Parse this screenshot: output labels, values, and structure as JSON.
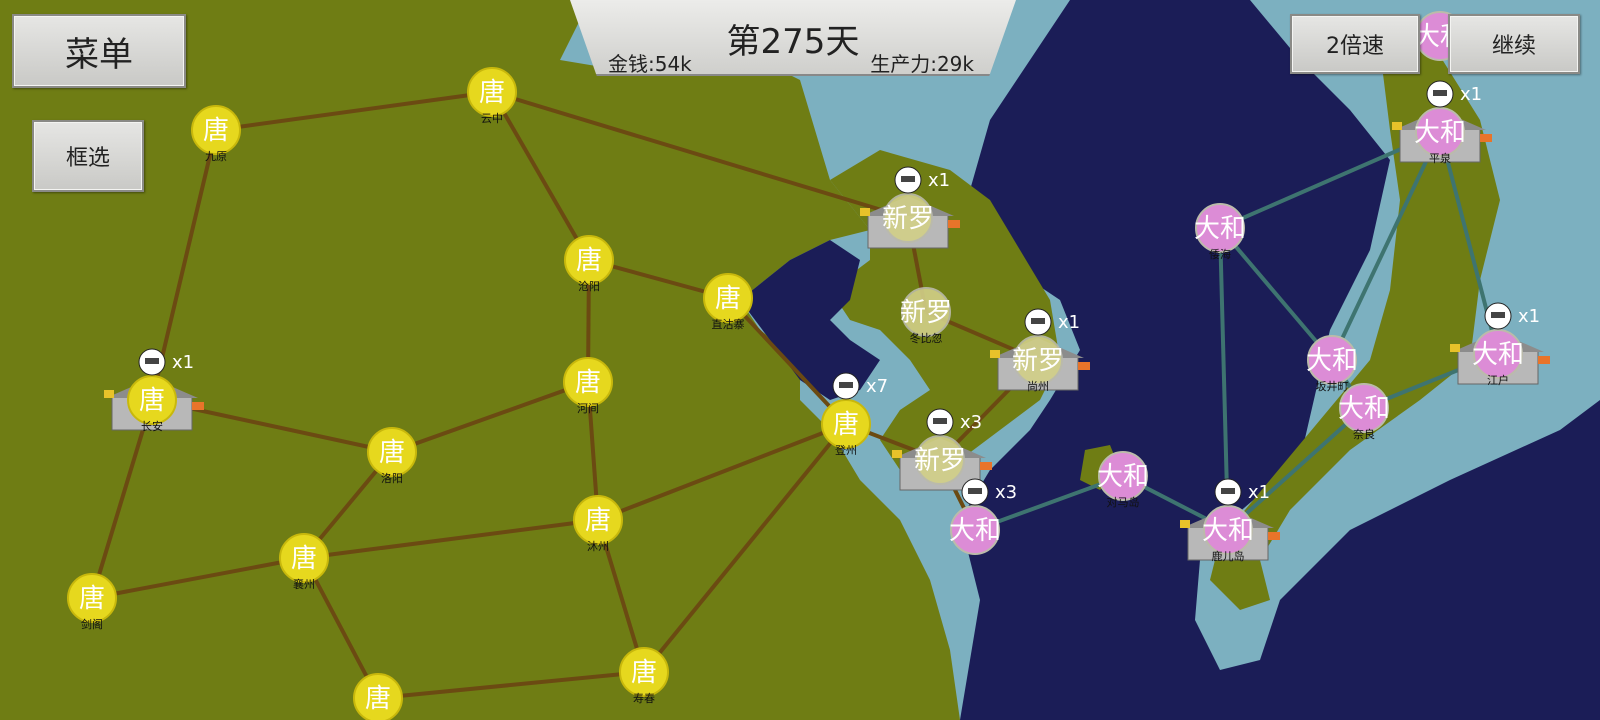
{
  "hud": {
    "day": "第275天",
    "money": "金钱:54k",
    "production": "生产力:29k"
  },
  "buttons": {
    "menu": "菜单",
    "select": "框选",
    "speed": "2倍速",
    "continue": "继续"
  },
  "colors": {
    "tang": "#e6d81e",
    "silla": "#d2d088",
    "yamato": "#dc8cd6",
    "land": "#6f7d14",
    "shallow_sea": "#7cb0c0",
    "deep_sea": "#1b1d57",
    "road": "#6b4a12",
    "sea_route": "#3e7470"
  },
  "map": {
    "cities": [
      {
        "id": "c1",
        "faction": "唐",
        "kind": "tang",
        "name": "九原"
      },
      {
        "id": "c2",
        "faction": "唐",
        "kind": "tang",
        "name": "云中"
      },
      {
        "id": "c3",
        "faction": "唐",
        "kind": "tang",
        "name": "沧阳"
      },
      {
        "id": "c4",
        "faction": "唐",
        "kind": "tang",
        "name": "直沽寨"
      },
      {
        "id": "c5",
        "faction": "唐",
        "kind": "tang",
        "name": "河间"
      },
      {
        "id": "c6",
        "faction": "唐",
        "kind": "tang",
        "name": "长安",
        "army": "x1",
        "castle": true
      },
      {
        "id": "c7",
        "faction": "唐",
        "kind": "tang",
        "name": "洛阳"
      },
      {
        "id": "c8",
        "faction": "唐",
        "kind": "tang",
        "name": "登州",
        "army": "x7"
      },
      {
        "id": "c9",
        "faction": "唐",
        "kind": "tang",
        "name": "沐州"
      },
      {
        "id": "c10",
        "faction": "唐",
        "kind": "tang",
        "name": "襄州"
      },
      {
        "id": "c11",
        "faction": "唐",
        "kind": "tang",
        "name": "剑阁"
      },
      {
        "id": "c12",
        "faction": "唐",
        "kind": "tang",
        "name": "寿春"
      },
      {
        "id": "c13",
        "faction": "唐",
        "kind": "tang",
        "name": ""
      },
      {
        "id": "c14",
        "faction": "新罗",
        "kind": "silla",
        "name": "",
        "army": "x1",
        "castle": true
      },
      {
        "id": "c15",
        "faction": "新罗",
        "kind": "silla",
        "name": "冬比忽"
      },
      {
        "id": "c16",
        "faction": "新罗",
        "kind": "silla",
        "name": "尚州",
        "army": "x1",
        "castle": true
      },
      {
        "id": "c17",
        "faction": "新罗",
        "kind": "silla",
        "name": "",
        "army": "x3",
        "castle": true
      },
      {
        "id": "c18",
        "faction": "大和",
        "kind": "yamato",
        "name": "",
        "army": "x3"
      },
      {
        "id": "c19",
        "faction": "大和",
        "kind": "yamato",
        "name": "对马岛"
      },
      {
        "id": "c20",
        "faction": "大和",
        "kind": "yamato",
        "name": "倭海"
      },
      {
        "id": "c21",
        "faction": "大和",
        "kind": "yamato",
        "name": "鹿儿岛",
        "army": "x1",
        "castle": true
      },
      {
        "id": "c22",
        "faction": "大和",
        "kind": "yamato",
        "name": "坂井町"
      },
      {
        "id": "c23",
        "faction": "大和",
        "kind": "yamato",
        "name": "奈良"
      },
      {
        "id": "c24",
        "faction": "大和",
        "kind": "yamato",
        "name": "平泉",
        "army": "x1",
        "castle": true
      },
      {
        "id": "c25",
        "faction": "大和",
        "kind": "yamato",
        "name": "江户",
        "army": "x1",
        "castle": true
      },
      {
        "id": "c26",
        "faction": "大和",
        "kind": "yamato",
        "name": ""
      }
    ],
    "roads": [
      [
        "c1",
        "c2"
      ],
      [
        "c2",
        "c3"
      ],
      [
        "c3",
        "c4"
      ],
      [
        "c3",
        "c5"
      ],
      [
        "c5",
        "c7"
      ],
      [
        "c5",
        "c9"
      ],
      [
        "c6",
        "c7"
      ],
      [
        "c7",
        "c10"
      ],
      [
        "c10",
        "c9"
      ],
      [
        "c10",
        "c11"
      ],
      [
        "c10",
        "c13"
      ],
      [
        "c13",
        "c12"
      ],
      [
        "c9",
        "c12"
      ],
      [
        "c9",
        "c8"
      ],
      [
        "c8",
        "c12"
      ],
      [
        "c6",
        "c1"
      ],
      [
        "c6",
        "c11"
      ],
      [
        "c4",
        "c8"
      ],
      [
        "c14",
        "c15"
      ],
      [
        "c15",
        "c16"
      ],
      [
        "c16",
        "c17"
      ],
      [
        "c8",
        "c17"
      ],
      [
        "c17",
        "c18"
      ],
      [
        "c2",
        "c14"
      ]
    ],
    "sea_routes": [
      [
        "c18",
        "c19"
      ],
      [
        "c19",
        "c21"
      ],
      [
        "c20",
        "c21"
      ],
      [
        "c20",
        "c24"
      ],
      [
        "c22",
        "c23"
      ],
      [
        "c23",
        "c21"
      ],
      [
        "c23",
        "c25"
      ],
      [
        "c24",
        "c25"
      ],
      [
        "c24",
        "c22"
      ],
      [
        "c20",
        "c22"
      ]
    ]
  }
}
